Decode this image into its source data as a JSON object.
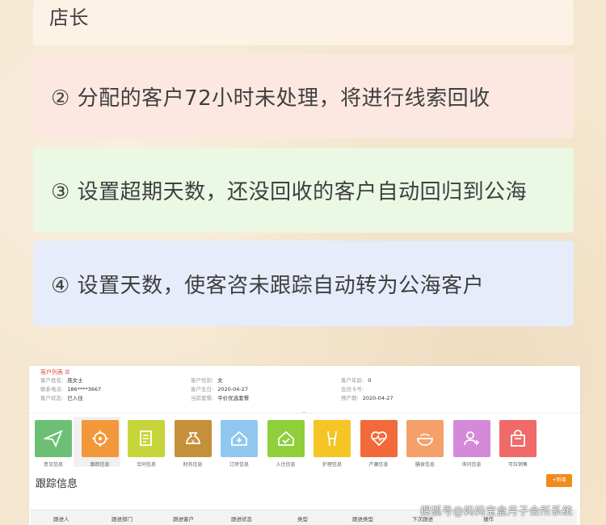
{
  "cards": [
    {
      "text": "店长"
    },
    {
      "text": "② 分配的客户72小时未处理，将进行线索回收"
    },
    {
      "text": "③ 设置超期天数，还没回收的客户自动回归到公海"
    },
    {
      "text": "④ 设置天数，使客咨未跟踪自动转为公海客户"
    }
  ],
  "crm": {
    "breadcrumb": "客户列表 ☰",
    "info_left": [
      {
        "k": "客户姓名:",
        "v": "庞女士"
      },
      {
        "k": "联系电话:",
        "v": "186****3667"
      },
      {
        "k": "客户状态:",
        "v": "已入住"
      }
    ],
    "info_mid": [
      {
        "k": "客户性别:",
        "v": "女"
      },
      {
        "k": "客户生日:",
        "v": "2020-04-27"
      },
      {
        "k": "当前套餐:",
        "v": "平价优选套餐"
      }
    ],
    "info_right": [
      {
        "k": "客户年龄:",
        "v": "0"
      },
      {
        "k": "会员卡号:",
        "v": ""
      },
      {
        "k": "预产期:",
        "v": "2020-04-27"
      }
    ],
    "tiles": [
      {
        "label": "意见信息",
        "color": "#6cbf74",
        "icon": "paper-plane-icon"
      },
      {
        "label": "跟踪信息",
        "color": "#f3983a",
        "icon": "target-icon"
      },
      {
        "label": "合同信息",
        "color": "#c6d53a",
        "icon": "contract-icon"
      },
      {
        "label": "财务信息",
        "color": "#c6903a",
        "icon": "money-bag-icon"
      },
      {
        "label": "订房信息",
        "color": "#8fc7ee",
        "icon": "house-plus-icon"
      },
      {
        "label": "入住信息",
        "color": "#8fcf3a",
        "icon": "house-check-icon"
      },
      {
        "label": "护理信息",
        "color": "#f5c425",
        "icon": "body-icon"
      },
      {
        "label": "产康信息",
        "color": "#f26a3a",
        "icon": "heart-pulse-icon"
      },
      {
        "label": "膳食信息",
        "color": "#f5a06a",
        "icon": "bowl-icon"
      },
      {
        "label": "询问信息",
        "color": "#d48ad8",
        "icon": "user-add-icon"
      },
      {
        "label": "可拉销售",
        "color": "#f06a6a",
        "icon": "shopping-bag-icon"
      }
    ],
    "section_title": "跟踪信息",
    "add_button": "+新增",
    "table_headers": [
      "跟进人",
      "跟进部门",
      "跟进客户",
      "跟进状态",
      "类型",
      "跟进类型",
      "下次跟进",
      "操作"
    ]
  },
  "watermark": "搜狐号@妈妈宝盒月子会所系统",
  "colors": {
    "background": "#f5e7cf",
    "card1": "#fdf2e6",
    "card2": "#fde8e1",
    "card3": "#eaf8e4",
    "card4": "#e7ecfb",
    "accent": "#f28a1c"
  }
}
